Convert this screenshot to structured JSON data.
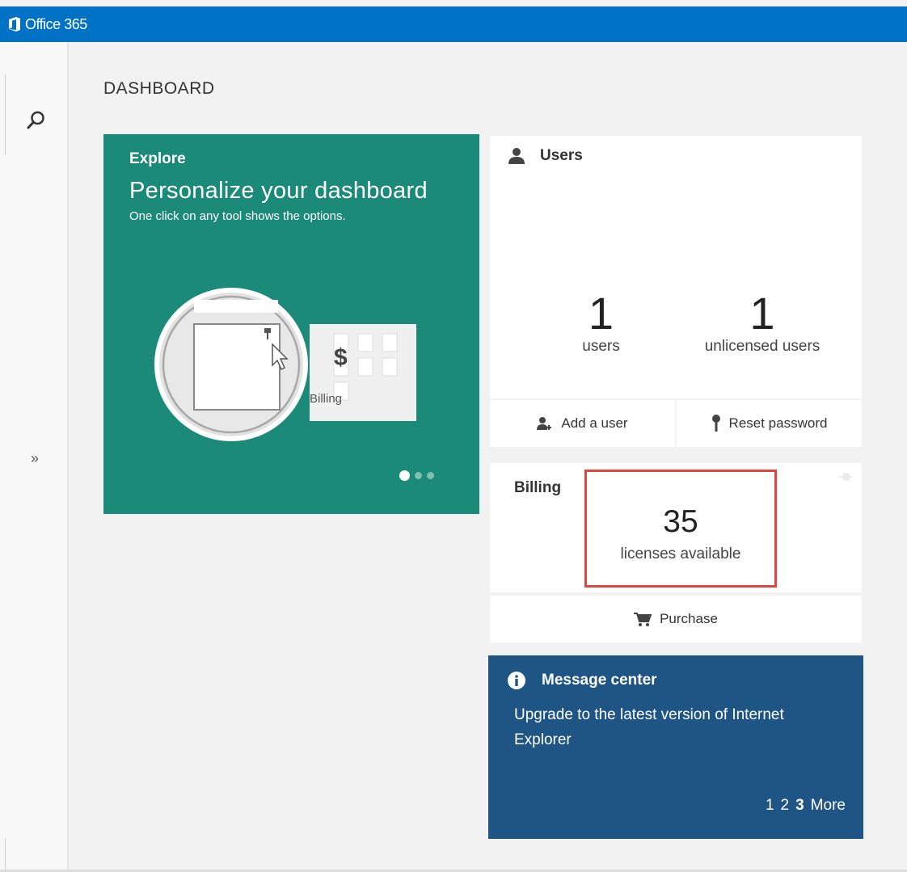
{
  "app": {
    "title": "Office 365"
  },
  "colors": {
    "brand": "#0072c6",
    "explore_tile": "#1b8a78",
    "message_tile": "#1e5585",
    "highlight_border": "#e0463d"
  },
  "nav": {
    "search_icon": "search-icon",
    "expand_icon": "»"
  },
  "page": {
    "title": "DASHBOARD"
  },
  "explore": {
    "eyebrow": "Explore",
    "headline": "Personalize your dashboard",
    "subtext": "One click on any tool shows the options.",
    "illustration_label": "Billing",
    "illustration_symbol": "$",
    "carousel": {
      "active": 1,
      "count": 3
    }
  },
  "users": {
    "title": "Users",
    "users_count": "1",
    "users_label": "users",
    "unlicensed_count": "1",
    "unlicensed_label": "unlicensed users",
    "actions": {
      "add_user": "Add a user",
      "reset_password": "Reset password"
    }
  },
  "billing": {
    "title": "Billing",
    "licenses_count": "35",
    "licenses_label": "licenses available",
    "purchase": "Purchase"
  },
  "message_center": {
    "title": "Message center",
    "body": "Upgrade to the latest version of Internet Explorer",
    "pages": [
      "1",
      "2",
      "3"
    ],
    "current_page": "3",
    "more": "More"
  }
}
